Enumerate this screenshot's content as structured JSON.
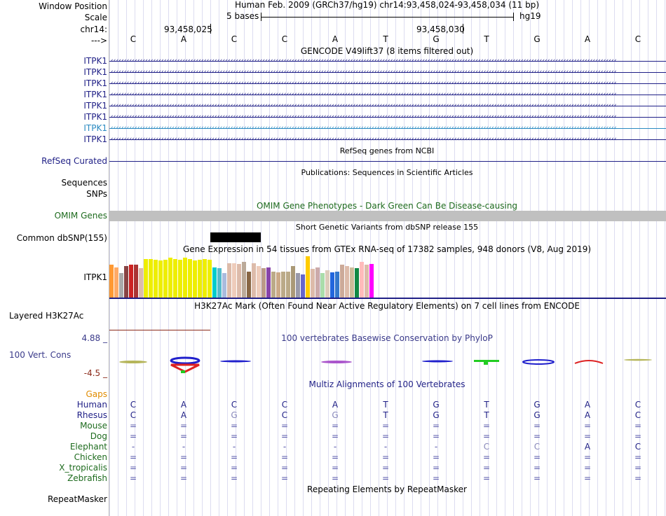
{
  "header": {
    "position_label": "Window Position",
    "position_text": "Human Feb. 2009 (GRCh37/hg19)   chr14:93,458,024-93,458,034 (11 bp)",
    "scale_label": "Scale",
    "scale_text": "5 bases",
    "scale_db": "hg19",
    "chrom_label": "chr14:",
    "coord1": "93,458,025",
    "coord2": "93,458,030",
    "strand_label": "--->"
  },
  "ruler_bases": [
    "C",
    "A",
    "C",
    "C",
    "A",
    "T",
    "G",
    "T",
    "G",
    "A",
    "C"
  ],
  "gencode": {
    "title": "GENCODE V49lift37 (8 items filtered out)",
    "items": [
      {
        "label": "ITPK1",
        "color": "#1f1f86"
      },
      {
        "label": "ITPK1",
        "color": "#1f1f86"
      },
      {
        "label": "ITPK1",
        "color": "#1f1f86"
      },
      {
        "label": "ITPK1",
        "color": "#1f1f86"
      },
      {
        "label": "ITPK1",
        "color": "#1f1f86"
      },
      {
        "label": "ITPK1",
        "color": "#1f1f86"
      },
      {
        "label": "ITPK1",
        "color": "#2a8ac1"
      },
      {
        "label": "ITPK1",
        "color": "#1f1f86"
      }
    ]
  },
  "refseq": {
    "title": "RefSeq genes from NCBI",
    "label": "RefSeq Curated"
  },
  "publications": {
    "title": "Publications: Sequences in Scientific Articles",
    "label1": "Sequences",
    "label2": "SNPs"
  },
  "omim": {
    "title": "OMIM Gene Phenotypes - Dark Green Can Be Disease-causing",
    "label": "OMIM Genes"
  },
  "dbsnp": {
    "title": "Short Genetic Variants from dbSNP release 155",
    "label": "Common dbSNP(155)"
  },
  "gtex": {
    "title": "Gene Expression in 54 tissues from GTEx RNA-seq of 17382 samples, 948 donors (V8, Aug 2019)",
    "label": "ITPK1",
    "bars": [
      {
        "value": 0.78,
        "color": "#ff9933"
      },
      {
        "value": 0.72,
        "color": "#ffaa66"
      },
      {
        "value": 0.58,
        "color": "#aaaaaa"
      },
      {
        "value": 0.75,
        "color": "#884444"
      },
      {
        "value": 0.78,
        "color": "#cc2222"
      },
      {
        "value": 0.78,
        "color": "#aa3333"
      },
      {
        "value": 0.7,
        "color": "#ddbbaa"
      },
      {
        "value": 0.92,
        "color": "#eeee00"
      },
      {
        "value": 0.92,
        "color": "#eeee00"
      },
      {
        "value": 0.9,
        "color": "#eeee00"
      },
      {
        "value": 0.88,
        "color": "#eeee00"
      },
      {
        "value": 0.9,
        "color": "#eeee00"
      },
      {
        "value": 0.95,
        "color": "#eeee00"
      },
      {
        "value": 0.92,
        "color": "#eeee00"
      },
      {
        "value": 0.9,
        "color": "#eeee00"
      },
      {
        "value": 0.95,
        "color": "#eeee00"
      },
      {
        "value": 0.92,
        "color": "#eeee00"
      },
      {
        "value": 0.88,
        "color": "#eeee00"
      },
      {
        "value": 0.9,
        "color": "#eeee00"
      },
      {
        "value": 0.92,
        "color": "#eeee00"
      },
      {
        "value": 0.9,
        "color": "#eeee00"
      },
      {
        "value": 0.72,
        "color": "#00cccc"
      },
      {
        "value": 0.7,
        "color": "#55bbcc"
      },
      {
        "value": 0.58,
        "color": "#aabbdd"
      },
      {
        "value": 0.82,
        "color": "#ddbbaa"
      },
      {
        "value": 0.82,
        "color": "#eeccbb"
      },
      {
        "value": 0.8,
        "color": "#ddbbaa"
      },
      {
        "value": 0.85,
        "color": "#bbaa99"
      },
      {
        "value": 0.62,
        "color": "#886644"
      },
      {
        "value": 0.82,
        "color": "#ddbbaa"
      },
      {
        "value": 0.75,
        "color": "#eeccbb"
      },
      {
        "value": 0.7,
        "color": "#bb9988"
      },
      {
        "value": 0.72,
        "color": "#8844aa"
      },
      {
        "value": 0.62,
        "color": "#bbaa88"
      },
      {
        "value": 0.6,
        "color": "#ccaa88"
      },
      {
        "value": 0.62,
        "color": "#bbaa88"
      },
      {
        "value": 0.62,
        "color": "#bbaa88"
      },
      {
        "value": 0.75,
        "color": "#aa9977"
      },
      {
        "value": 0.58,
        "color": "#9999aa"
      },
      {
        "value": 0.55,
        "color": "#6666cc"
      },
      {
        "value": 0.98,
        "color": "#ffcc00"
      },
      {
        "value": 0.68,
        "color": "#ddbbaa"
      },
      {
        "value": 0.72,
        "color": "#ccaaaa"
      },
      {
        "value": 0.58,
        "color": "#aaddaa"
      },
      {
        "value": 0.65,
        "color": "#ddccbb"
      },
      {
        "value": 0.6,
        "color": "#2266dd"
      },
      {
        "value": 0.62,
        "color": "#3377cc"
      },
      {
        "value": 0.78,
        "color": "#ccaa99"
      },
      {
        "value": 0.75,
        "color": "#ddbbaa"
      },
      {
        "value": 0.72,
        "color": "#ccbb99"
      },
      {
        "value": 0.7,
        "color": "#118844"
      },
      {
        "value": 0.85,
        "color": "#ffbbbb"
      },
      {
        "value": 0.78,
        "color": "#ddbbaa"
      },
      {
        "value": 0.8,
        "color": "#ff00ff"
      }
    ]
  },
  "h3k27ac": {
    "title": "H3K27Ac Mark (Often Found Near Active Regulatory Elements) on 7 cell lines from ENCODE",
    "label": "Layered H3K27Ac"
  },
  "phylop": {
    "title": "100 vertebrates Basewise Conservation by PhyloP",
    "label": "100 Vert. Cons",
    "max": "4.88 _",
    "min": "-4.5 _"
  },
  "multiz": {
    "title": "Multiz Alignments of 100 Vertebrates",
    "gaps_label": "Gaps",
    "species": [
      {
        "name": "Human",
        "color": "#1f1f86",
        "bases": [
          "C",
          "A",
          "C",
          "C",
          "A",
          "T",
          "G",
          "T",
          "G",
          "A",
          "C"
        ],
        "dim": []
      },
      {
        "name": "Rhesus",
        "color": "#1f1f86",
        "bases": [
          "C",
          "A",
          "G",
          "C",
          "G",
          "T",
          "G",
          "T",
          "G",
          "A",
          "C"
        ],
        "dim": [
          2,
          4
        ]
      },
      {
        "name": "Mouse",
        "color": "#1e6b1e",
        "bases": [
          "=",
          "=",
          "=",
          "=",
          "=",
          "=",
          "=",
          "=",
          "=",
          "=",
          "="
        ],
        "dim": []
      },
      {
        "name": "Dog",
        "color": "#1e6b1e",
        "bases": [
          "=",
          "=",
          "=",
          "=",
          "=",
          "=",
          "=",
          "=",
          "=",
          "=",
          "="
        ],
        "dim": []
      },
      {
        "name": "Elephant",
        "color": "#1e6b1e",
        "bases": [
          "-",
          "-",
          "-",
          "-",
          "-",
          "-",
          "-",
          "C",
          "C",
          "A",
          "C"
        ],
        "dim": [
          7,
          8
        ]
      },
      {
        "name": "Chicken",
        "color": "#1e6b1e",
        "bases": [
          "=",
          "=",
          "=",
          "=",
          "=",
          "=",
          "=",
          "=",
          "=",
          "=",
          "="
        ],
        "dim": []
      },
      {
        "name": "X_tropicalis",
        "color": "#1e6b1e",
        "bases": [
          "=",
          "=",
          "=",
          "=",
          "=",
          "=",
          "=",
          "=",
          "=",
          "=",
          "="
        ],
        "dim": []
      },
      {
        "name": "Zebrafish",
        "color": "#1e6b1e",
        "bases": [
          "=",
          "=",
          "=",
          "=",
          "=",
          "=",
          "=",
          "=",
          "=",
          "=",
          "="
        ],
        "dim": []
      }
    ]
  },
  "repeatmasker": {
    "title": "Repeating Elements by RepeatMasker",
    "label": "RepeatMasker"
  }
}
